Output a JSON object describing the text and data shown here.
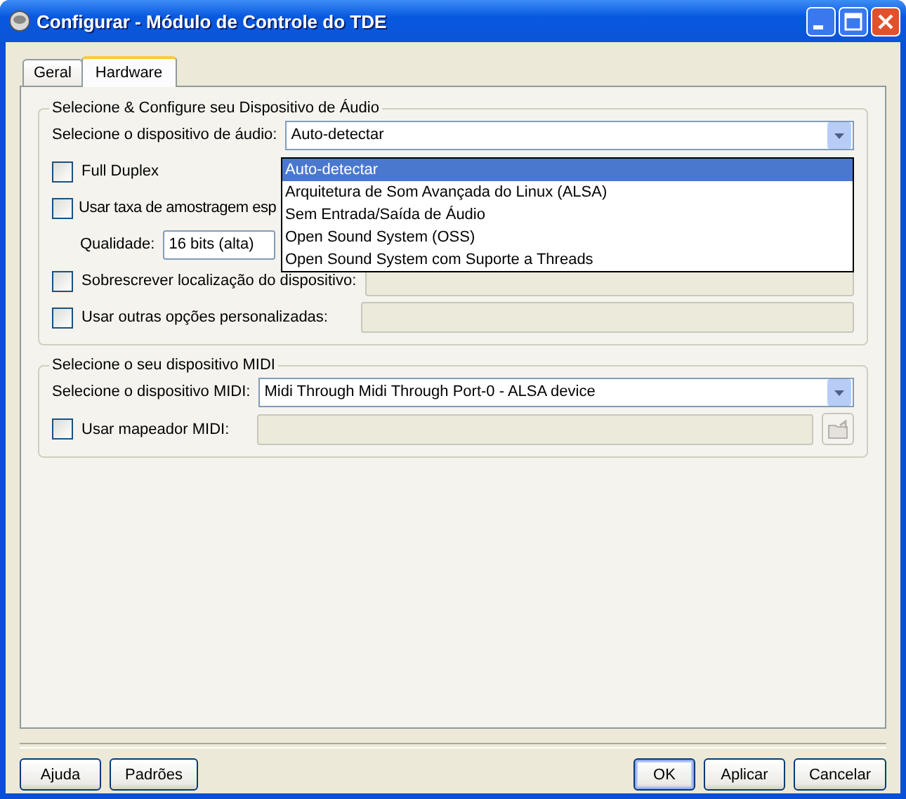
{
  "window": {
    "title": "Configurar - Módulo de Controle do TDE"
  },
  "tabs": [
    {
      "label": "Geral",
      "selected": false
    },
    {
      "label": "Hardware",
      "selected": true
    }
  ],
  "audio_group": {
    "title": "Selecione & Configure seu Dispositivo de Áudio",
    "device_label": "Selecione o dispositivo de áudio:",
    "device_value": "Auto-detectar",
    "dropdown_items": [
      {
        "label": "Auto-detectar",
        "selected": true
      },
      {
        "label": "Arquitetura de Som Avançada do Linux (ALSA)",
        "selected": false
      },
      {
        "label": "Sem Entrada/Saída de Áudio",
        "selected": false
      },
      {
        "label": "Open Sound System (OSS)",
        "selected": false
      },
      {
        "label": "Open Sound System com Suporte a Threads",
        "selected": false
      }
    ],
    "full_duplex": {
      "label": "Full Duplex",
      "checked": false
    },
    "custom_rate": {
      "label": "Usar taxa de amostragem esp",
      "checked": false
    },
    "quality_label": "Qualidade:",
    "quality_value": "16 bits (alta)",
    "override_location": {
      "label": "Sobrescrever localização do dispositivo:",
      "checked": false
    },
    "custom_options": {
      "label": "Usar outras opções personalizadas:",
      "checked": false
    }
  },
  "midi_group": {
    "title": "Selecione o seu dispositivo MIDI",
    "device_label": "Selecione o dispositivo MIDI:",
    "device_value": "Midi Through  Midi Through Port-0 - ALSA device",
    "use_mapper": {
      "label": "Usar mapeador MIDI:",
      "checked": false
    }
  },
  "buttons_left": [
    "Ajuda",
    "Padrões"
  ],
  "buttons_right": [
    {
      "label": "OK",
      "default": true
    },
    {
      "label": "Aplicar",
      "default": false
    },
    {
      "label": "Cancelar",
      "default": false
    }
  ]
}
